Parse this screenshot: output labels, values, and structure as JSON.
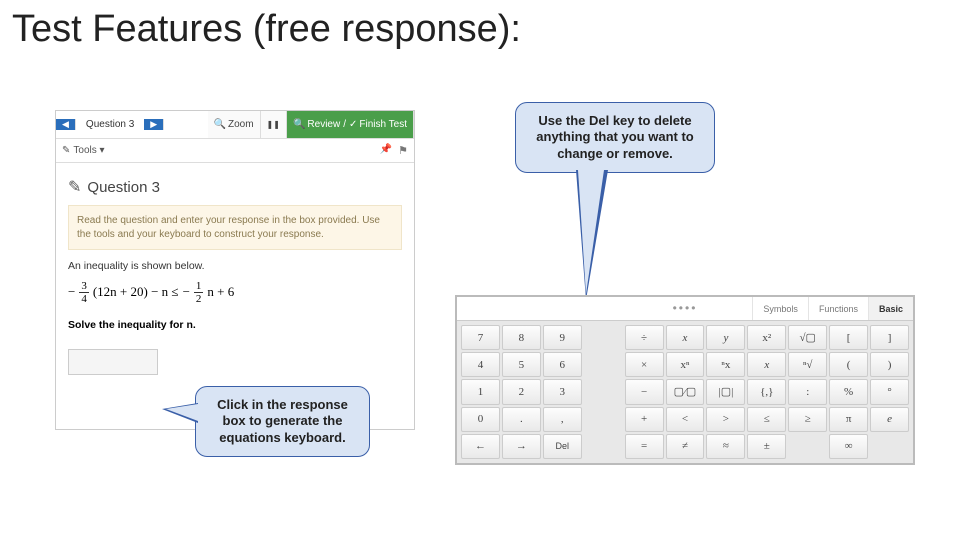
{
  "slide": {
    "title": "Test Features (free response):"
  },
  "callouts": {
    "left": "Click in the response box to generate the equations keyboard.",
    "top": "Use the Del key to delete anything that you want to change or remove."
  },
  "panel": {
    "nav": {
      "question_label": "Question 3",
      "zoom": "Zoom",
      "review": "Review",
      "finish": "Finish Test",
      "tools": "Tools"
    },
    "heading": "Question 3",
    "instructions": "Read the question and enter your response in the box provided. Use the tools and your keyboard to construct your response.",
    "prompt": "An inequality is shown below.",
    "math": {
      "f1n": "3",
      "f1d": "4",
      "mid": "(12n + 20) − n ≤",
      "f2n": "1",
      "f2d": "2",
      "tail": "n + 6",
      "lead": "−"
    },
    "solve": "Solve the inequality for n."
  },
  "keyboard": {
    "tabs": {
      "symbols": "Symbols",
      "functions": "Functions",
      "basic": "Basic"
    },
    "rows": [
      [
        "7",
        "8",
        "9",
        "÷",
        "x",
        "y",
        "x²",
        "√▢",
        "[",
        "]"
      ],
      [
        "4",
        "5",
        "6",
        "×",
        "xⁿ",
        "ⁿx",
        "x",
        "ⁿ√",
        "(",
        ")"
      ],
      [
        "1",
        "2",
        "3",
        "−",
        "▢⁄▢",
        "|▢|",
        "{,}",
        ":",
        "%",
        "°"
      ],
      [
        "0",
        ".",
        ",",
        "+",
        "<",
        ">",
        "≤",
        "≥",
        "π",
        "e"
      ],
      [
        "←",
        "→",
        "Del",
        "=",
        "≠",
        "≈",
        "±",
        "",
        "∞",
        ""
      ]
    ]
  }
}
